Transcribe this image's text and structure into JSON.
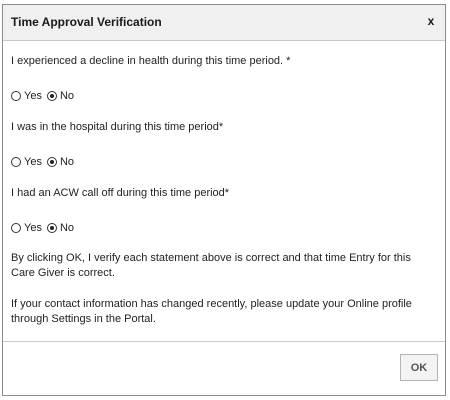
{
  "dialog": {
    "title": "Time Approval Verification",
    "close_label": "x"
  },
  "questions": [
    {
      "text": "I experienced a decline in health during this time period. *",
      "options": [
        "Yes",
        "No"
      ],
      "selected": "No"
    },
    {
      "text": "I was in the hospital during this time period*",
      "options": [
        "Yes",
        "No"
      ],
      "selected": "No"
    },
    {
      "text": "I had an ACW call off during this time period*",
      "options": [
        "Yes",
        "No"
      ],
      "selected": "No"
    }
  ],
  "notes": {
    "verify": "By clicking OK, I verify each statement above is correct and that time Entry for this Care Giver is correct.",
    "contact": "If your contact information has changed recently, please update your Online profile through Settings in the Portal."
  },
  "footer": {
    "ok_label": "OK"
  }
}
